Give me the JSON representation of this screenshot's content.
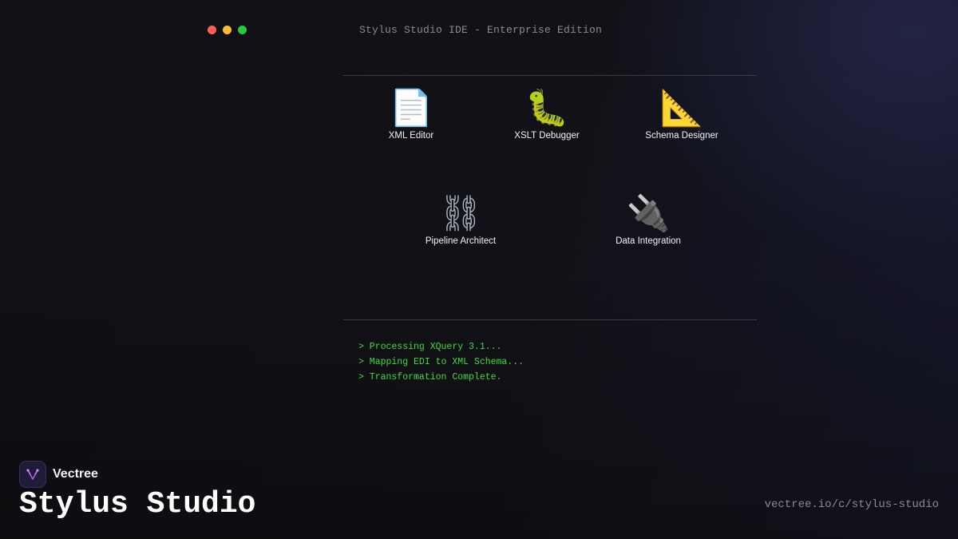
{
  "window": {
    "title": "Stylus Studio IDE - Enterprise Edition",
    "controls": [
      "close",
      "minimize",
      "maximize"
    ]
  },
  "tools": [
    {
      "label": "XML Editor",
      "icon": "document-icon",
      "glyph": "📄"
    },
    {
      "label": "XSLT Debugger",
      "icon": "bug-icon",
      "glyph": "🐛"
    },
    {
      "label": "Schema Designer",
      "icon": "triangle-ruler-icon",
      "glyph": "📐"
    },
    {
      "label": "Pipeline Architect",
      "icon": "chain-link-icon",
      "glyph": "⛓"
    },
    {
      "label": "Data Integration",
      "icon": "electric-plug-icon",
      "glyph": "🔌"
    }
  ],
  "console": {
    "lines": [
      "> Processing XQuery 3.1...",
      "> Mapping EDI to XML Schema...",
      "> Transformation Complete."
    ]
  },
  "brand": {
    "name": "Vectree",
    "logo_icon": "vectree-logo-icon",
    "product": "Stylus Studio",
    "url": "vectree.io/c/stylus-studio"
  },
  "colors": {
    "background": "#111116",
    "console_text": "#3ddc3d",
    "close": "#ff5f57",
    "minimize": "#febc2e",
    "maximize": "#28c840",
    "brand_logo_bg": "#1f1c3a",
    "brand_logo_accent": "#b45ae6"
  }
}
